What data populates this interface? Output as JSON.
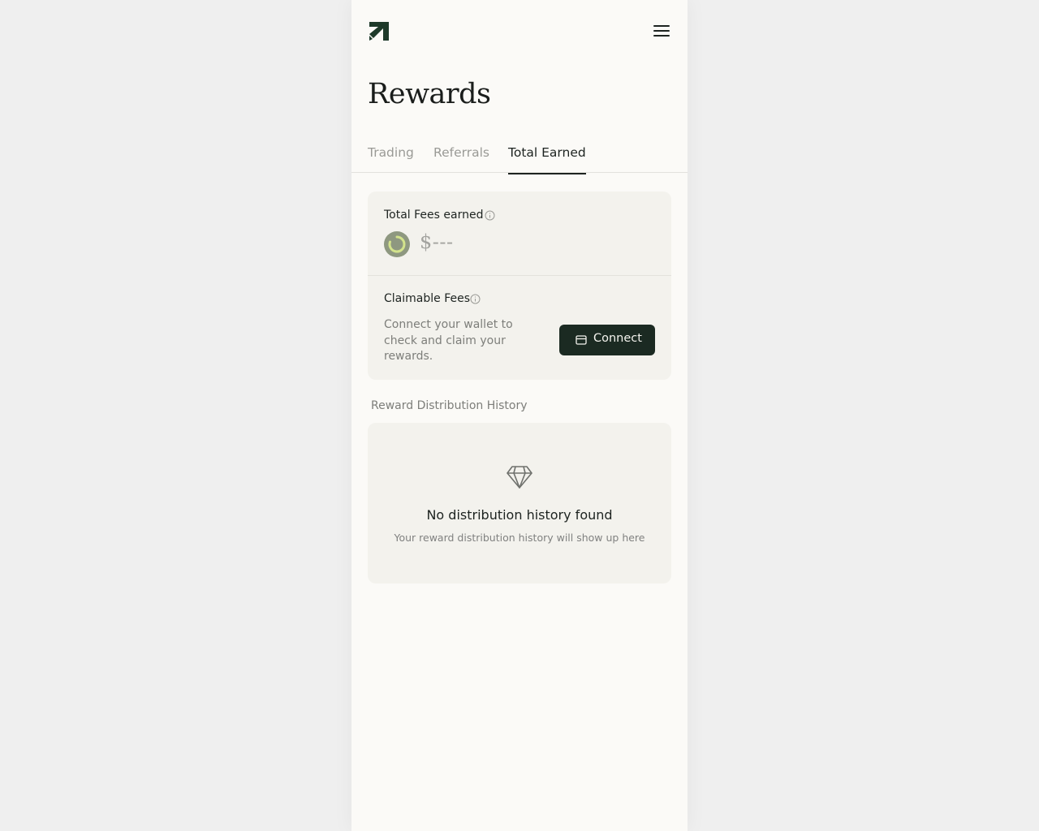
{
  "page": {
    "title": "Rewards"
  },
  "tabs": [
    {
      "label": "Trading",
      "active": false
    },
    {
      "label": "Referrals",
      "active": false
    },
    {
      "label": "Total Earned",
      "active": true
    }
  ],
  "fees_card": {
    "total_label": "Total Fees earned",
    "total_value": "$---",
    "claimable_label": "Claimable Fees",
    "claimable_description": "Connect your wallet to check and claim your rewards.",
    "connect_label": "Connect"
  },
  "history": {
    "heading": "Reward Distribution History",
    "empty_title": "No distribution history found",
    "empty_subtitle": "Your reward distribution history will show up here"
  },
  "icons": {
    "logo": "brand-logo-icon",
    "menu": "hamburger-menu-icon",
    "info": "info-icon",
    "loading": "loading-spinner-icon",
    "wallet": "wallet-icon",
    "empty": "diamond-icon"
  },
  "colors": {
    "accent": "#1b2a22",
    "page_bg": "#fbfaf7",
    "card_bg": "#f3f2ed",
    "spinner": "#c9d98a"
  }
}
